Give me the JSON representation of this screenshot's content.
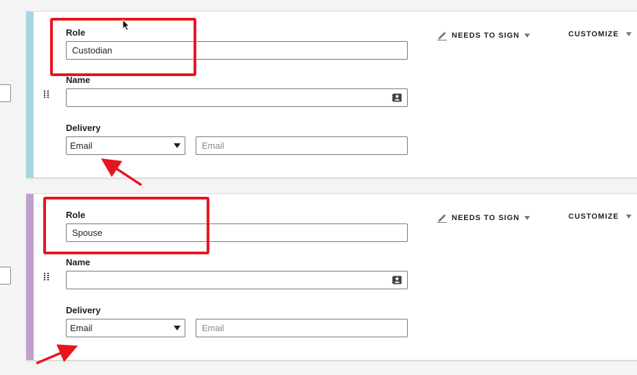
{
  "colors": {
    "card1_accent": "#a3d8e2",
    "card2_accent": "#bea0cf",
    "annotation": "#e8141e"
  },
  "recipients": [
    {
      "role_label": "Role",
      "role_value": "Custodian",
      "name_label": "Name",
      "name_value": "",
      "delivery_label": "Delivery",
      "delivery_selected": "Email",
      "email_placeholder": "Email",
      "signing_action": "NEEDS TO SIGN",
      "customize_label": "CUSTOMIZE"
    },
    {
      "role_label": "Role",
      "role_value": "Spouse",
      "name_label": "Name",
      "name_value": "",
      "delivery_label": "Delivery",
      "delivery_selected": "Email",
      "email_placeholder": "Email",
      "signing_action": "NEEDS TO SIGN",
      "customize_label": "CUSTOMIZE"
    }
  ],
  "icons": {
    "pen": "pen-icon",
    "contact": "contact-card-icon",
    "drag": "drag-handle-icon",
    "cursor": "mouse-cursor-icon"
  }
}
